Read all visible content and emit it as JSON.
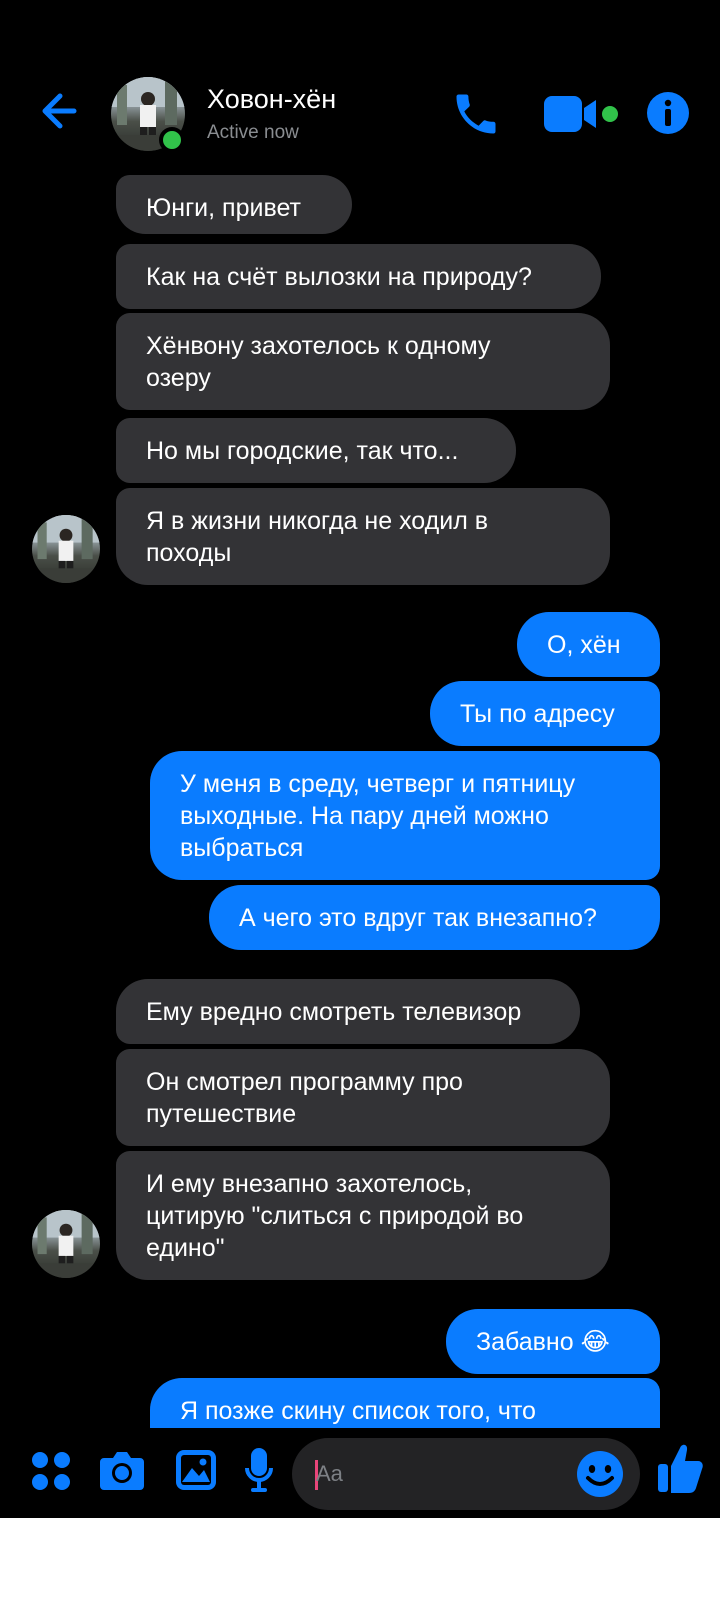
{
  "header": {
    "contact_name": "Ховон-хён",
    "status": "Active now"
  },
  "colors": {
    "accent": "#0a7cff",
    "incoming_bubble": "#333336",
    "online": "#31c24a",
    "background": "#000000"
  },
  "icons": [
    "back-arrow-icon",
    "phone-icon",
    "video-camera-icon",
    "info-icon",
    "apps-grid-icon",
    "camera-icon",
    "gallery-icon",
    "microphone-icon",
    "emoji-icon",
    "thumbs-up-icon"
  ],
  "messages": [
    {
      "side": "in",
      "text": "Юнги, привет"
    },
    {
      "side": "in",
      "text": "Как на счёт вылозки на природу?"
    },
    {
      "side": "in",
      "text": "Хёнвону захотелось к одному\nозеру"
    },
    {
      "side": "in",
      "text": "Но мы городские, так что..."
    },
    {
      "side": "in",
      "text": "Я в жизни никогда не ходил в\nпоходы"
    },
    {
      "side": "out",
      "text": "О, хён"
    },
    {
      "side": "out",
      "text": "Ты по адресу"
    },
    {
      "side": "out",
      "text": "У меня в среду, четверг и пятницу\nвыходные. На пару дней можно\nвыбраться"
    },
    {
      "side": "out",
      "text": "А чего это вдруг так внезапно?"
    },
    {
      "side": "in",
      "text": "Ему вредно смотреть телевизор"
    },
    {
      "side": "in",
      "text": "Он смотрел программу про\nпутешествие"
    },
    {
      "side": "in",
      "text": "И ему внезапно захотелось,\nцитирую \"слиться с природой во\nедино\""
    },
    {
      "side": "out",
      "text": "Забавно 😂"
    },
    {
      "side": "out",
      "text": "Я позже скину список того, что"
    }
  ],
  "composer": {
    "placeholder": "Aa"
  }
}
